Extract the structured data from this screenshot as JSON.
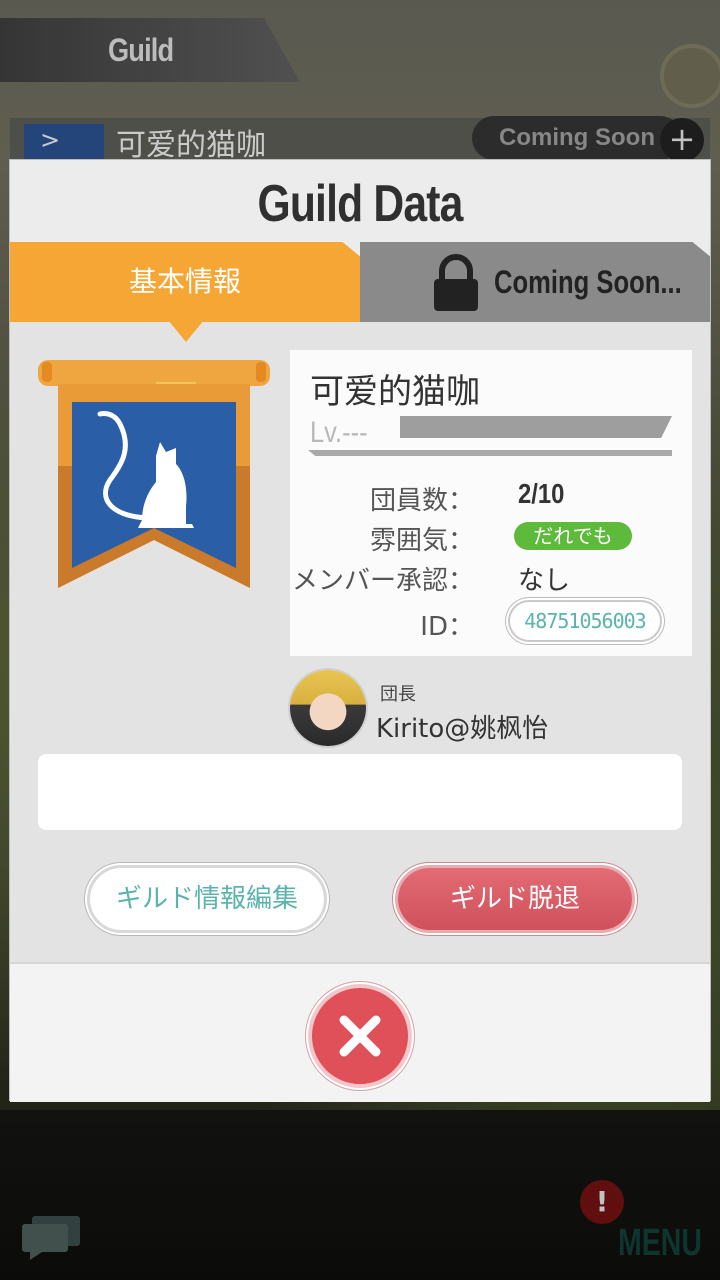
{
  "background": {
    "header_title": "Guild",
    "row_guild_name": "可爱的猫咖",
    "row_status": "Coming Soon",
    "row_action": "+",
    "alert_badge": "!",
    "menu_label": "MENU"
  },
  "dialog": {
    "title": "Guild Data",
    "tabs": {
      "basic": "基本情報",
      "locked": "Coming Soon..."
    },
    "guild": {
      "name": "可爱的猫咖",
      "level_label": "Lv.---",
      "members_label": "団員数：",
      "members_value": "2/10",
      "mood_label": "雰囲気：",
      "mood_value": "だれでも",
      "approval_label": "メンバー承認：",
      "approval_value": "なし",
      "id_label": "ID：",
      "id_value": "48751056003"
    },
    "leader": {
      "role": "団長",
      "name": "Kirito@姚枫怡"
    },
    "comment": "",
    "buttons": {
      "edit": "ギルド情報編集",
      "leave": "ギルド脱退"
    }
  },
  "colors": {
    "tab_active": "#f6a634",
    "tab_locked": "#8a8a8a",
    "emblem_blue": "#2a5fa8",
    "mood_badge": "#5dba3b",
    "leave_button": "#cf515c",
    "close_button": "#e05059",
    "teal_text": "#5bb3ad"
  },
  "icons": {
    "locked_tab": "padlock-icon",
    "emblem": "cat-icon",
    "close": "close-x-icon",
    "chat": "chat-icon"
  }
}
